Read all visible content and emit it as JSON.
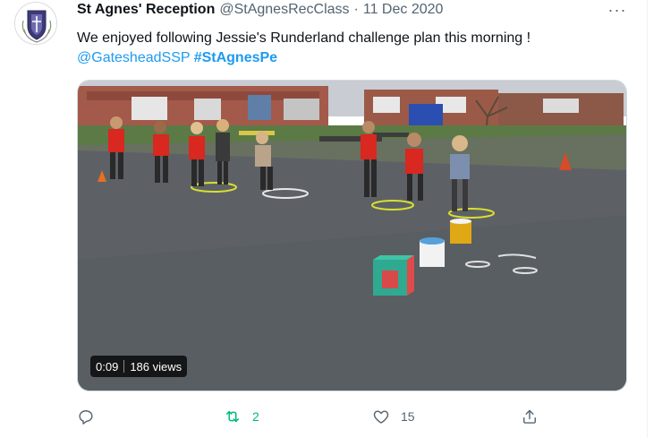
{
  "tweet": {
    "author_name": "St Agnes' Reception",
    "handle": "@StAgnesRecClass",
    "separator": "·",
    "date": "11 Dec 2020",
    "text": "We enjoyed following Jessie's Runderland challenge plan this morning !",
    "mention": "@GatesheadSSP",
    "hashtag": "#StAgnesPe",
    "more_icon": "more-horizontal-icon",
    "more_label": "···"
  },
  "video": {
    "duration": "0:09",
    "views": "186 views"
  },
  "actions": {
    "reply": {
      "icon": "reply-icon",
      "count": ""
    },
    "retweet": {
      "icon": "retweet-icon",
      "count": "2"
    },
    "like": {
      "icon": "heart-icon",
      "count": "15"
    },
    "share": {
      "icon": "share-icon",
      "count": ""
    }
  },
  "colors": {
    "link": "#1d9bf0",
    "secondary_text": "#536471",
    "retweet_active": "#00ba7c",
    "primary_text": "#0f1419"
  }
}
